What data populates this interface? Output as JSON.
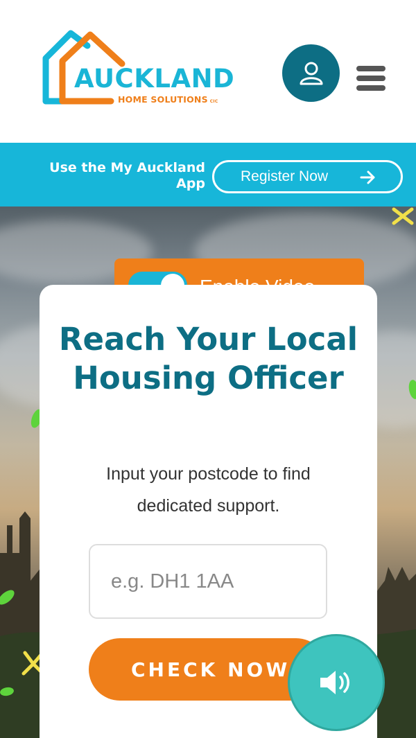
{
  "brand": {
    "name": "AUCKLAND",
    "tagline": "HOME SOLUTIONS",
    "suffix": "CIC",
    "colors": {
      "primary": "#0d6e84",
      "accent": "#17b6d9",
      "orange": "#ef7f1a",
      "audio": "#3ec4be"
    }
  },
  "header": {
    "account_icon": "user-icon",
    "menu_icon": "hamburger-menu-icon"
  },
  "app_banner": {
    "text": "Use the My Auckland App",
    "register_label": "Register Now",
    "register_icon": "arrow-right-icon"
  },
  "video_toggle": {
    "label": "Enable Video",
    "state": "on"
  },
  "card": {
    "title": "Reach Your Local Housing Officer",
    "description": "Input your postcode to find dedicated support.",
    "postcode_placeholder": "e.g. DH1 1AA",
    "postcode_value": "",
    "check_label": "CHECK NOW"
  },
  "audio": {
    "icon": "speaker-volume-icon"
  }
}
